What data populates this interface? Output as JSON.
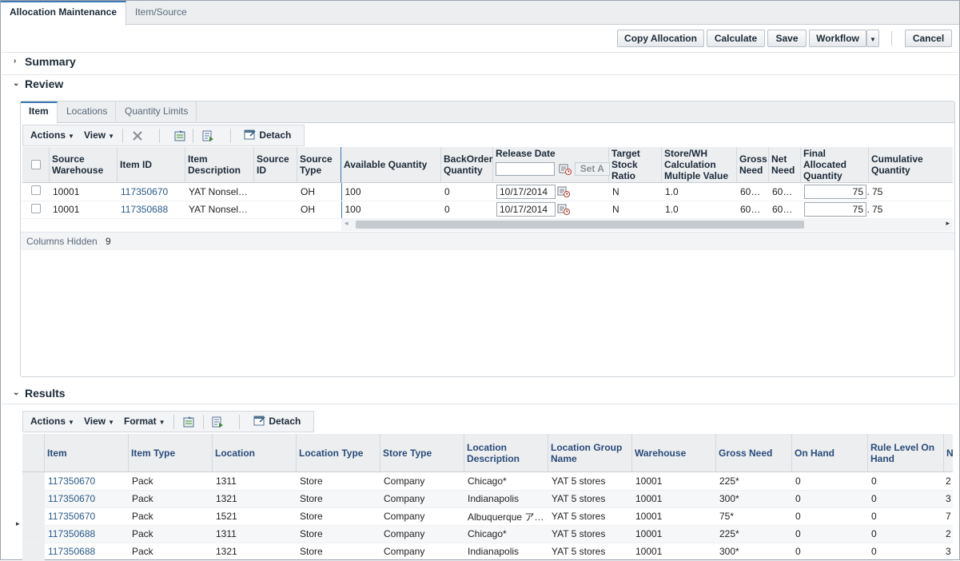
{
  "top_tabs": [
    "Allocation Maintenance",
    "Item/Source"
  ],
  "toolbar": {
    "copy_allocation": "Copy Allocation",
    "calculate": "Calculate",
    "save": "Save",
    "workflow": "Workflow",
    "cancel": "Cancel"
  },
  "sections": {
    "summary": "Summary",
    "review": "Review",
    "results": "Results"
  },
  "review": {
    "tabs": [
      "Item",
      "Locations",
      "Quantity Limits"
    ],
    "menus": {
      "actions": "Actions",
      "view": "View",
      "detach": "Detach"
    },
    "columns": {
      "source_warehouse": "Source Warehouse",
      "item_id": "Item ID",
      "item_description": "Item Description",
      "source_id": "Source ID",
      "source_type": "Source Type",
      "available_quantity": "Available Quantity",
      "backorder_quantity": "BackOrder Quantity",
      "release_date": "Release Date",
      "set_all": "Set A",
      "target_stock_ratio": "Target Stock Ratio",
      "store_wh_calc": "Store/WH Calculation Multiple Value",
      "gross_need": "Gross Need",
      "net_need": "Net Need",
      "final_allocated_quantity": "Final Allocated Quantity",
      "cumulative_quantity": "Cumulative Quantity"
    },
    "rows": [
      {
        "source_warehouse": "10001",
        "item_id": "117350670",
        "item_description": "YAT Nonsel…",
        "source_id": "",
        "source_type": "OH",
        "available_quantity": "100",
        "backorder_quantity": "0",
        "release_date": "10/17/2014",
        "target_stock_ratio": "N",
        "store_wh_calc": "1.0",
        "gross_need": "600…",
        "net_need": "600…",
        "final_allocated_quantity": "75",
        "cumulative_quantity": "75"
      },
      {
        "source_warehouse": "10001",
        "item_id": "117350688",
        "item_description": "YAT Nonsel…",
        "source_id": "",
        "source_type": "OH",
        "available_quantity": "100",
        "backorder_quantity": "0",
        "release_date": "10/17/2014",
        "target_stock_ratio": "N",
        "store_wh_calc": "1.0",
        "gross_need": "600…",
        "net_need": "600…",
        "final_allocated_quantity": "75",
        "cumulative_quantity": "75"
      }
    ],
    "columns_hidden_label": "Columns Hidden",
    "columns_hidden_count": "9"
  },
  "results": {
    "menus": {
      "actions": "Actions",
      "view": "View",
      "format": "Format",
      "detach": "Detach"
    },
    "columns": [
      "Item",
      "Item Type",
      "Location",
      "Location Type",
      "Store Type",
      "Location Description",
      "Location Group Name",
      "Warehouse",
      "Gross Need",
      "On Hand",
      "Rule Level On Hand",
      "N"
    ],
    "rows": [
      [
        "117350670",
        "Pack",
        "1311",
        "Store",
        "Company",
        "Chicago*",
        "YAT 5 stores",
        "10001",
        "225*",
        "0",
        "0",
        "2"
      ],
      [
        "117350670",
        "Pack",
        "1321",
        "Store",
        "Company",
        "Indianapolis",
        "YAT 5 stores",
        "10001",
        "300*",
        "0",
        "0",
        "3"
      ],
      [
        "117350670",
        "Pack",
        "1521",
        "Store",
        "Company",
        "Albuquerque ア…",
        "YAT 5 stores",
        "10001",
        "75*",
        "0",
        "0",
        "7"
      ],
      [
        "117350688",
        "Pack",
        "1311",
        "Store",
        "Company",
        "Chicago*",
        "YAT 5 stores",
        "10001",
        "225*",
        "0",
        "0",
        "2"
      ],
      [
        "117350688",
        "Pack",
        "1321",
        "Store",
        "Company",
        "Indianapolis",
        "YAT 5 stores",
        "10001",
        "300*",
        "0",
        "0",
        "3"
      ]
    ]
  },
  "icons": [
    "delete-icon",
    "export-icon",
    "wrap-icon",
    "detach-icon",
    "calendar-icon",
    "chevron-right-icon",
    "chevron-down-icon"
  ]
}
